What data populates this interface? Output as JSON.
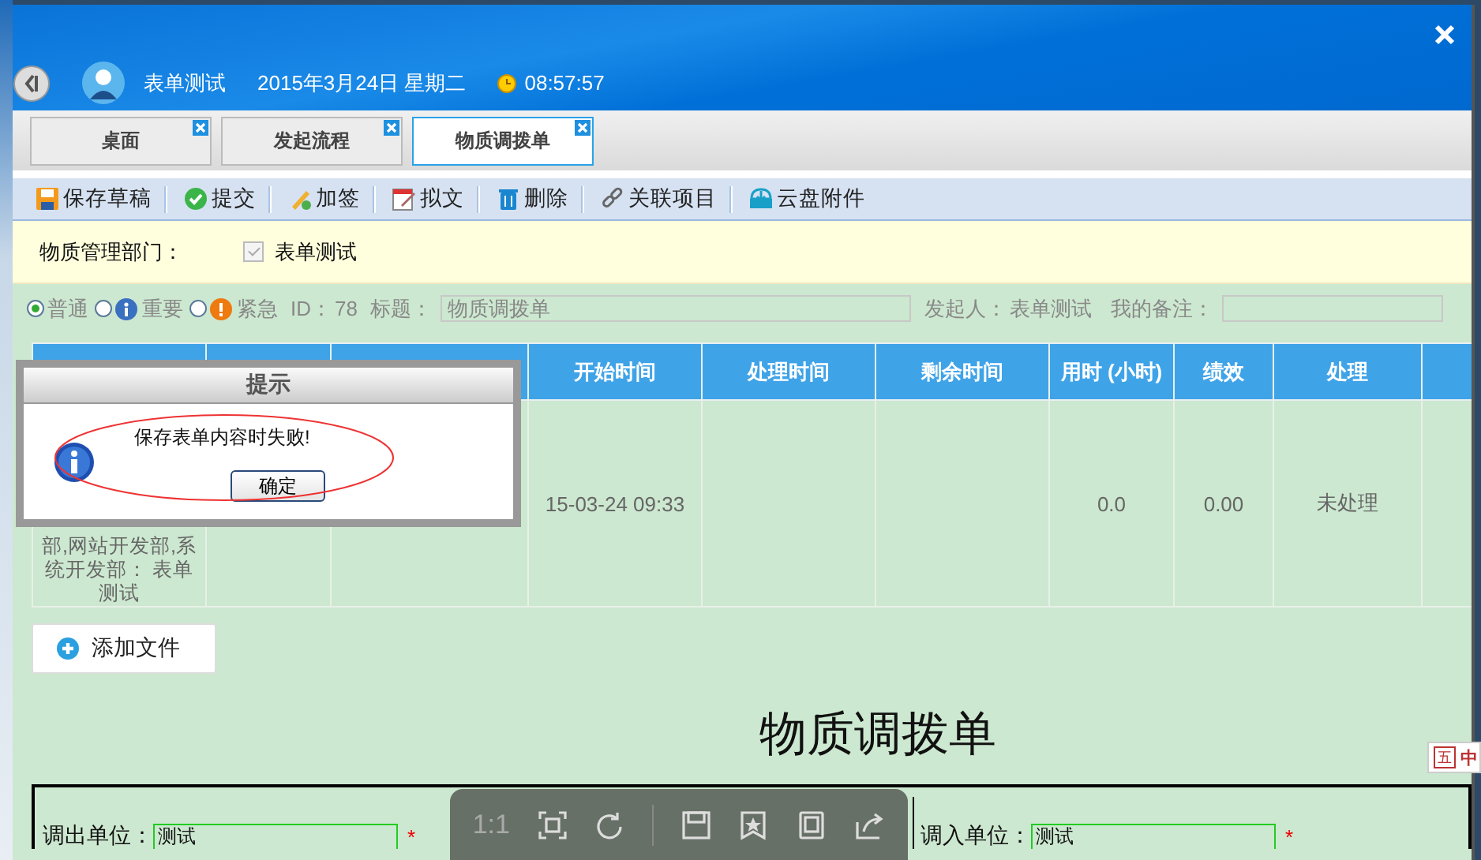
{
  "header": {
    "user": "表单测试",
    "date": "2015年3月24日 星期二",
    "time": "08:57:57"
  },
  "tabs": [
    {
      "label": "桌面",
      "selected": false
    },
    {
      "label": "发起流程",
      "selected": false
    },
    {
      "label": "物质调拨单",
      "selected": true
    }
  ],
  "toolbar": [
    {
      "label": "保存草稿",
      "kind": "save"
    },
    {
      "label": "提交",
      "kind": "submit"
    },
    {
      "label": "加签",
      "kind": "sign"
    },
    {
      "label": "拟文",
      "kind": "draft"
    },
    {
      "label": "删除",
      "kind": "delete"
    },
    {
      "label": "关联项目",
      "kind": "link"
    },
    {
      "label": "云盘附件",
      "kind": "cloud"
    }
  ],
  "department": {
    "label": "物质管理部门：",
    "option": "表单测试",
    "checked": true,
    "disabled": true
  },
  "priority": {
    "options": [
      {
        "label": "普通",
        "kind": "normal",
        "selected": true
      },
      {
        "label": "重要",
        "kind": "important",
        "selected": false
      },
      {
        "label": "紧急",
        "kind": "urgent",
        "selected": false
      }
    ],
    "id_label": "ID：",
    "id": "78",
    "title_label": "标题：",
    "title_value": "物质调拨单",
    "initiator_label": "发起人：",
    "initiator": "表单测试",
    "note_label": "我的备注："
  },
  "table": {
    "columns": [
      {},
      {},
      {},
      {
        "label": "开始时间"
      },
      {
        "label": "处理时间"
      },
      {
        "label": "剩余时间"
      },
      {
        "label": "用时 (小时)"
      },
      {
        "label": "绩效"
      },
      {
        "label": "处理"
      },
      {}
    ],
    "rows": [
      {
        "cells": [
          "部,网站开发部,系统开发部： 表单测试",
          null,
          null,
          "15-03-24 09:33",
          null,
          null,
          "0.0",
          "0.00",
          "未处理",
          null
        ]
      }
    ]
  },
  "add_file_button": "添加文件",
  "form": {
    "title": "物质调拨单",
    "fields": [
      {
        "label": "调出单位：",
        "value": "测试",
        "required_mark": "*"
      },
      {
        "label": "调入单位：",
        "value": "测试",
        "required_mark": "*"
      }
    ]
  },
  "dialog": {
    "title": "提示",
    "message": "保存表单内容时失败!",
    "button": "确定"
  },
  "viewer_toolbar": {
    "zoom_label": "1:1"
  },
  "ime": {
    "icon_text": "五",
    "label": "中"
  }
}
